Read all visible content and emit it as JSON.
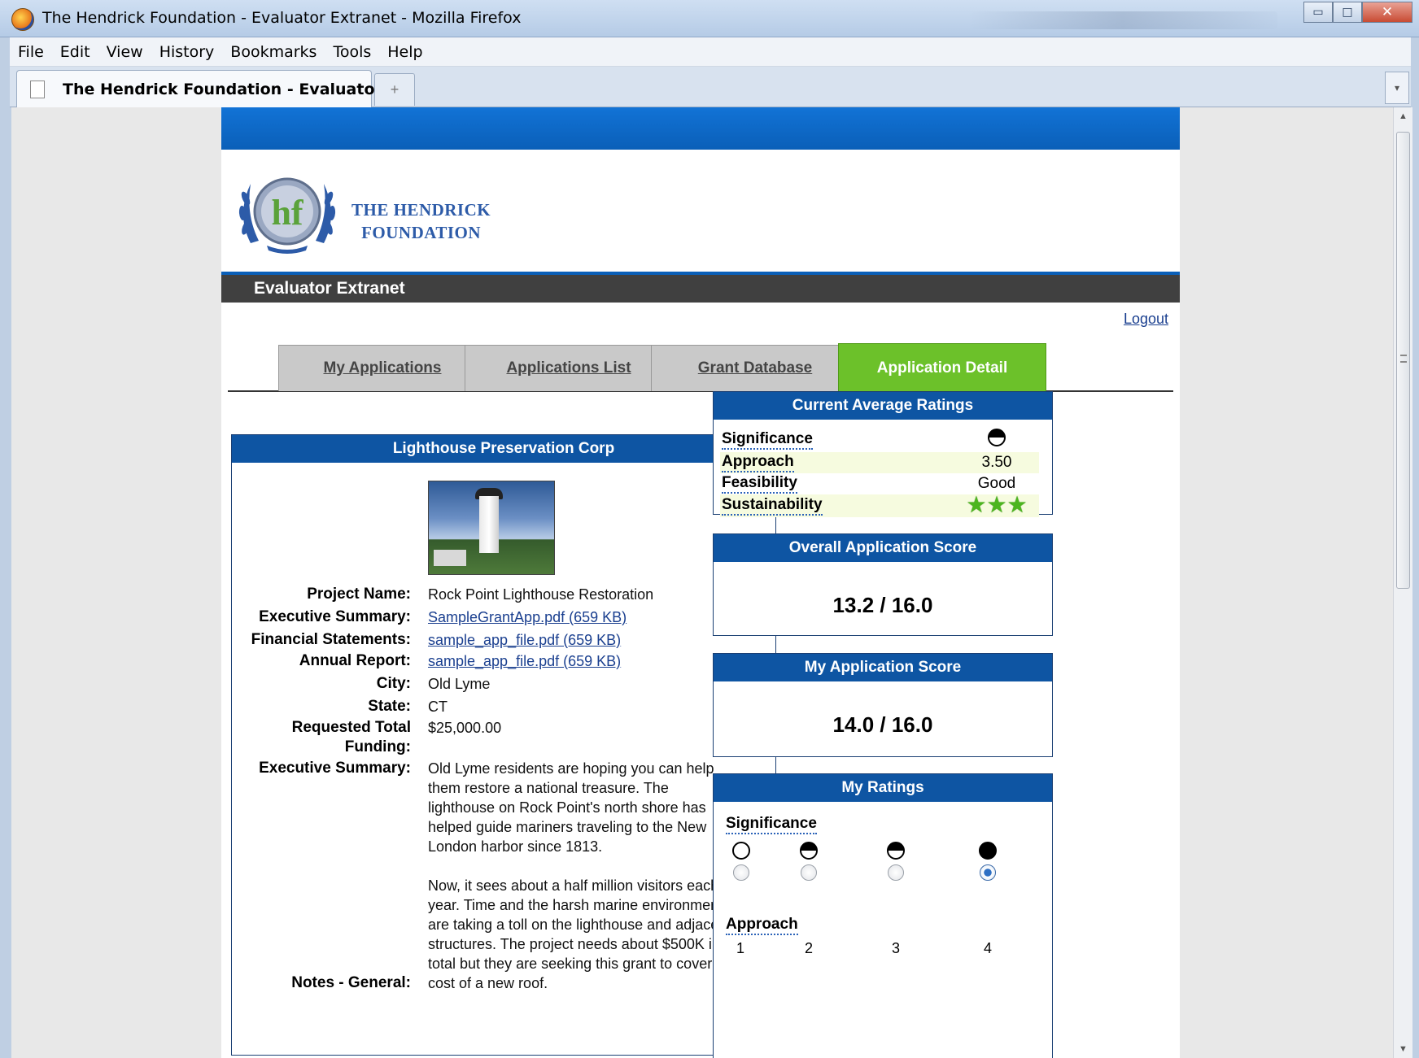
{
  "window": {
    "title": "The Hendrick Foundation - Evaluator Extranet - Mozilla Firefox",
    "controls": {
      "minimize": "▭",
      "maximize": "□",
      "close": "✕"
    }
  },
  "menubar": [
    "File",
    "Edit",
    "View",
    "History",
    "Bookmarks",
    "Tools",
    "Help"
  ],
  "browser_tab": {
    "label": "The Hendrick Foundation - Evaluator ...",
    "new_tab": "+",
    "tab_list": "▾"
  },
  "scrollbar": {
    "up": "▲",
    "down": "▼"
  },
  "site": {
    "logo_line1": "THE HENDRICK",
    "logo_line2": "FOUNDATION",
    "section_bar": "Evaluator Extranet",
    "logout": "Logout",
    "tabs": [
      {
        "label": "My Applications",
        "active": false
      },
      {
        "label": "Applications List",
        "active": false
      },
      {
        "label": "Grant Database",
        "active": false
      },
      {
        "label": "Application Detail",
        "active": true
      }
    ]
  },
  "application": {
    "title": "Lighthouse Preservation Corp",
    "fields": [
      {
        "label": "Project Name:",
        "value": "Rock Point Lighthouse Restoration",
        "link": false
      },
      {
        "label": "Executive Summary:",
        "value": "SampleGrantApp.pdf (659 KB)",
        "link": true
      },
      {
        "label": "Financial Statements:",
        "value": "sample_app_file.pdf (659 KB)",
        "link": true
      },
      {
        "label": "Annual Report:",
        "value": "sample_app_file.pdf (659 KB)",
        "link": true
      },
      {
        "label": "City:",
        "value": "Old Lyme",
        "link": false
      },
      {
        "label": "State:",
        "value": "CT",
        "link": false
      }
    ],
    "requested_label_1": "Requested Total",
    "requested_label_2": "Funding:",
    "requested_value": "$25,000.00",
    "summary_label": "Executive Summary:",
    "summary_p1": "Old Lyme residents are hoping you can help them restore a national treasure. The lighthouse on Rock Point's north shore has helped guide mariners traveling to the New London harbor since 1813.",
    "summary_p2": "Now, it sees about a half million visitors each year. Time and the harsh marine environment are taking a toll on the lighthouse and adjacent structures. The project needs about $500K in total but they are seeking this grant to cover the cost of a new roof.",
    "notes_label": "Notes - General:"
  },
  "average_ratings": {
    "title": "Current Average Ratings",
    "rows": [
      {
        "label": "Significance",
        "display": "icon",
        "fill": 0.5
      },
      {
        "label": "Approach",
        "display": "text",
        "value": "3.50"
      },
      {
        "label": "Feasibility",
        "display": "text",
        "value": "Good"
      },
      {
        "label": "Sustainability",
        "display": "stars",
        "stars": 3
      }
    ]
  },
  "overall_score": {
    "title": "Overall Application Score",
    "value": "13.2 / 16.0"
  },
  "my_score": {
    "title": "My Application Score",
    "value": "14.0 / 16.0"
  },
  "my_ratings": {
    "title": "My Ratings",
    "significance": {
      "label": "Significance",
      "options": 4,
      "selected_index": 3,
      "fills": [
        0,
        0.5,
        0.5,
        1
      ]
    },
    "approach": {
      "label": "Approach",
      "numbers": [
        "1",
        "2",
        "3",
        "4"
      ]
    }
  },
  "colors": {
    "topbar": "#0a5fb8",
    "section_bar": "#404040",
    "active_tab": "#6cc12a",
    "panel_header": "#0e55a3",
    "link": "#1a3f8f",
    "star": "#4cb51f"
  }
}
